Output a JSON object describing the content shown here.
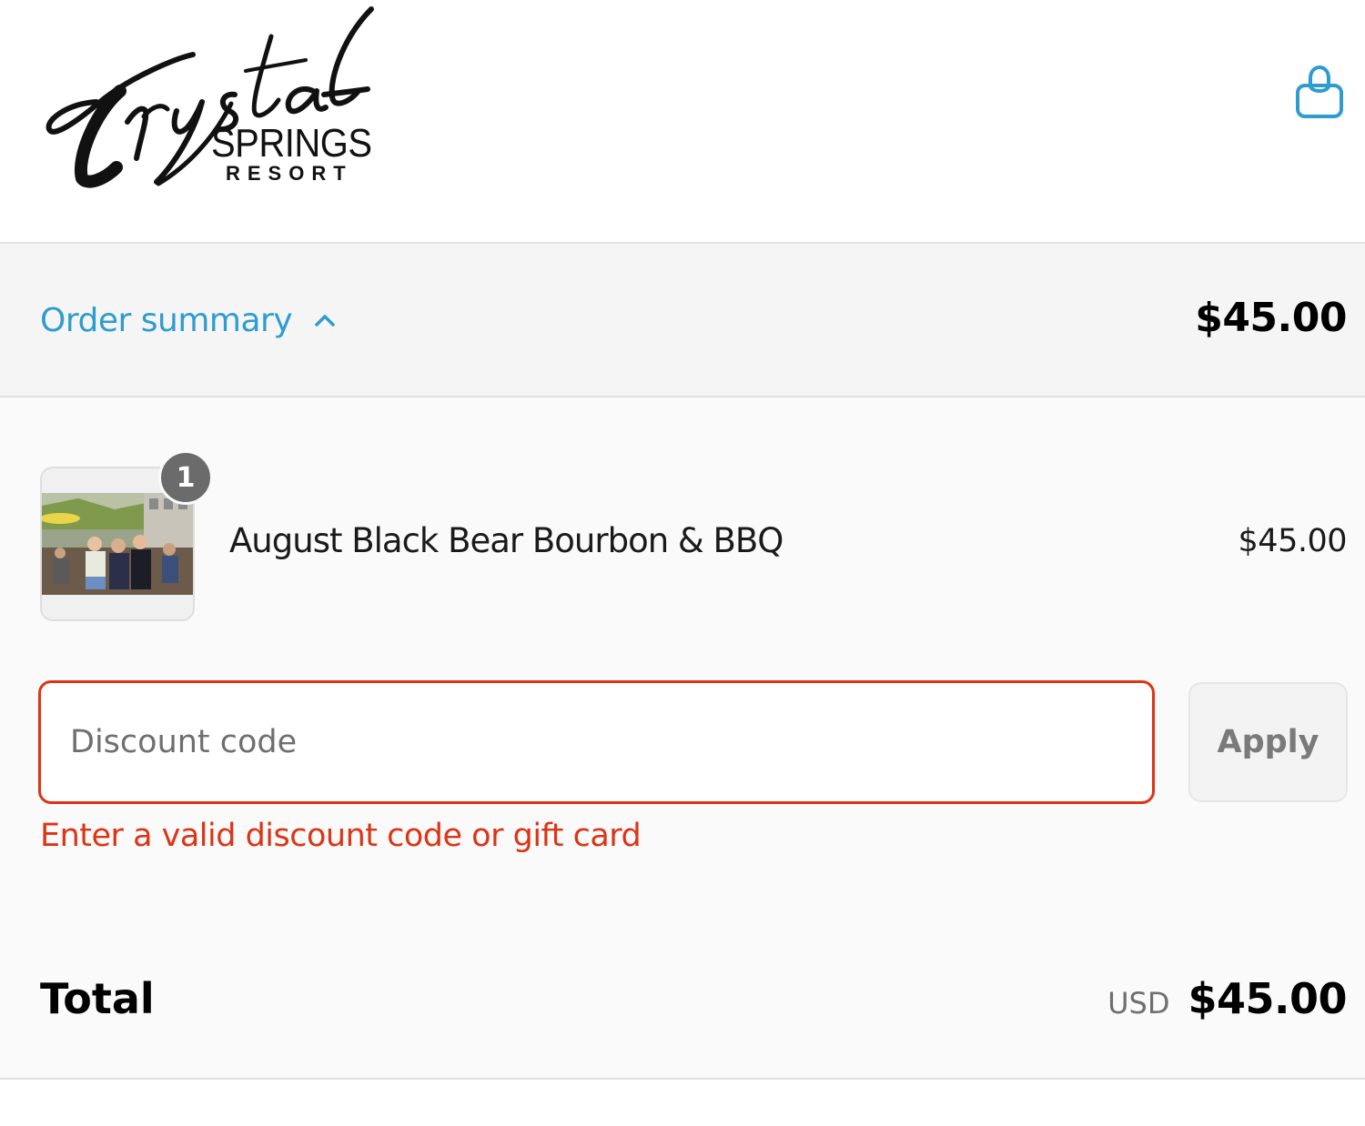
{
  "header": {
    "logo": {
      "script_text": "Crystal",
      "line2": "SPRINGS",
      "line3": "RESORT"
    },
    "cart_icon": "shopping-bag-icon"
  },
  "summary": {
    "toggle_label": "Order summary",
    "toggle_icon": "chevron-up-icon",
    "total": "$45.00"
  },
  "line_items": [
    {
      "quantity": "1",
      "name": "August Black Bear Bourbon & BBQ",
      "price": "$45.00"
    }
  ],
  "discount": {
    "placeholder": "Discount code",
    "value": "",
    "apply_label": "Apply",
    "error": "Enter a valid discount code or gift card"
  },
  "totals": {
    "label": "Total",
    "currency": "USD",
    "amount": "$45.00"
  },
  "colors": {
    "accent": "#2e9ccf",
    "error": "#dd3416",
    "badge": "#6b6b6b"
  }
}
